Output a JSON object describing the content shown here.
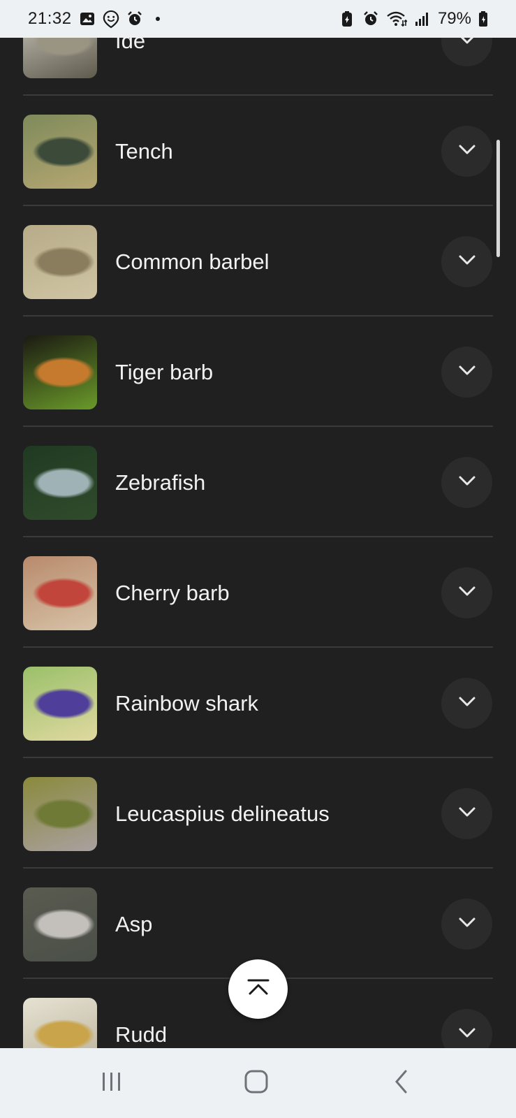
{
  "status_bar": {
    "time": "21:32",
    "left_icons": [
      "image-icon",
      "smiley-location-icon",
      "alarm-icon",
      "dot-icon"
    ],
    "right_icons": [
      "battery-saver-icon",
      "alarm-icon",
      "wifi-icon",
      "signal-icon"
    ],
    "battery": "79%"
  },
  "fish_list": [
    {
      "name": "Ide",
      "thumb_colors": [
        "#cfcbc0",
        "#9a9483",
        "#5e5a4c"
      ]
    },
    {
      "name": "Tench",
      "thumb_colors": [
        "#7f8a5b",
        "#3c4a3a",
        "#b5a772"
      ]
    },
    {
      "name": "Common barbel",
      "thumb_colors": [
        "#b7ab88",
        "#8a7d5e",
        "#cfc5a4"
      ]
    },
    {
      "name": "Tiger barb",
      "thumb_colors": [
        "#1b1a12",
        "#c67a2e",
        "#6a9a2a"
      ]
    },
    {
      "name": "Zebrafish",
      "thumb_colors": [
        "#1f3a22",
        "#9fb3b6",
        "#304b2b"
      ]
    },
    {
      "name": "Cherry barb",
      "thumb_colors": [
        "#b98a6c",
        "#c1453a",
        "#d7c3a8"
      ]
    },
    {
      "name": "Rainbow shark",
      "thumb_colors": [
        "#9ac06a",
        "#4f3f9a",
        "#e0d9a0"
      ]
    },
    {
      "name": "Leucaspius delineatus",
      "thumb_colors": [
        "#8a8a3c",
        "#6f7a36",
        "#aaa0a0"
      ]
    },
    {
      "name": "Asp",
      "thumb_colors": [
        "#5a5a50",
        "#c3c0bc",
        "#4a5048"
      ]
    },
    {
      "name": "Rudd",
      "thumb_colors": [
        "#e6e2d2",
        "#c9a44b",
        "#b9b09a"
      ]
    }
  ],
  "scroll_top_button": {
    "icon": "chevron-up-bar-icon"
  },
  "nav_bar": {
    "icons": [
      "recents-icon",
      "home-icon",
      "back-icon"
    ]
  }
}
